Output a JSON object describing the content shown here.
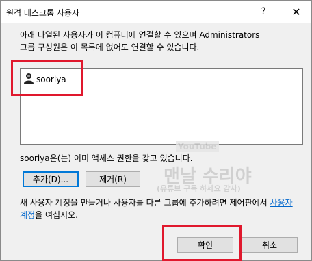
{
  "window": {
    "title": "원격 데스크톱 사용자",
    "help_glyph": "?",
    "close_glyph": "✕"
  },
  "description": "아래 나열된 사용자가 이 컴퓨터에 연결할 수 있으며 Administrators\n그룹 구성원은 이 목록에 없어도 연결할 수 있습니다.",
  "users": [
    {
      "name": "sooriya",
      "icon": "user-icon"
    }
  ],
  "status_text": "sooriya은(는) 이미 액세스 권한을 갖고 있습니다.",
  "buttons": {
    "add": "추가(D)...",
    "remove": "제거(R)",
    "ok": "확인",
    "cancel": "취소"
  },
  "info": {
    "text_before": "새 사용자 계정을 만들거나 사용자를 다른 그룹에 추가하려면 제어판에서 ",
    "link": "사용자 계정",
    "text_after": "을 여십시오."
  },
  "watermark": {
    "brand": "YouTube",
    "main": "맨날 수리야",
    "sub": "(유튜브 구독 하세요 감사)"
  }
}
